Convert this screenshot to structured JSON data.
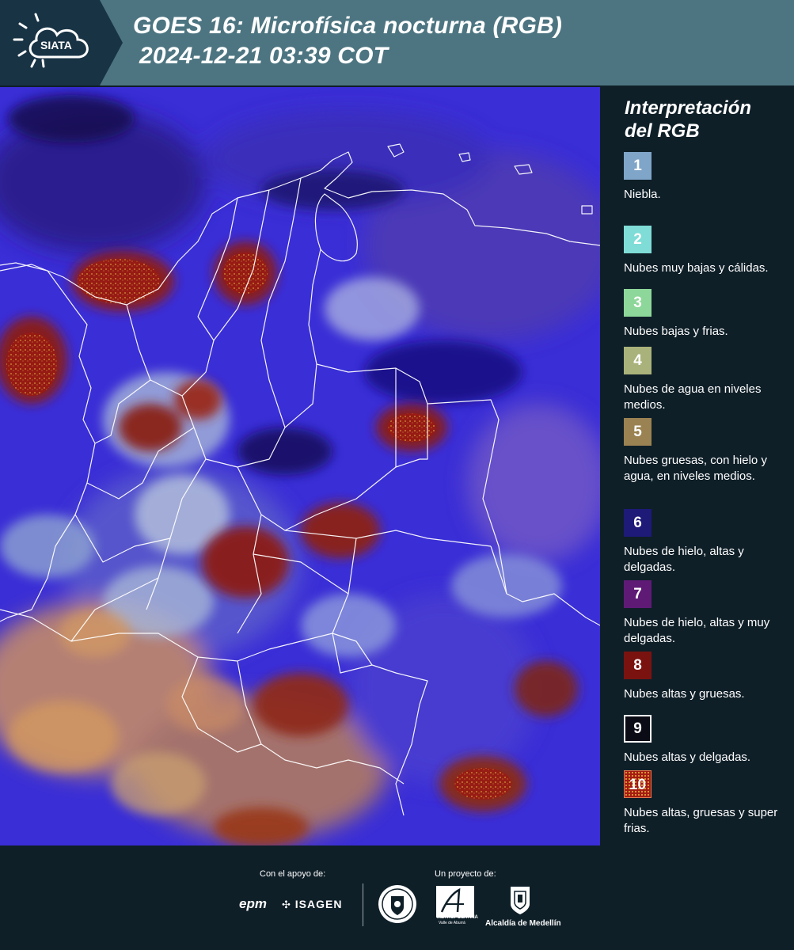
{
  "header": {
    "logo_text": "SIATA",
    "title_line1": "GOES 16: Microfísica nocturna (RGB)",
    "title_line2": "2024-12-21 03:39 COT"
  },
  "legend": {
    "title_line1": "Interpretación",
    "title_line2": "del RGB",
    "items": [
      {
        "number": "1",
        "color": "#7fa5c8",
        "label": "Niebla."
      },
      {
        "number": "2",
        "color": "#7fdcd6",
        "label": "Nubes muy bajas y cálidas."
      },
      {
        "number": "3",
        "color": "#8ed79a",
        "label": "Nubes bajas y frias."
      },
      {
        "number": "4",
        "color": "#a9b27a",
        "label": "Nubes de agua en niveles medios."
      },
      {
        "number": "5",
        "color": "#9a8252",
        "label": "Nubes gruesas, con hielo y agua, en niveles medios."
      },
      {
        "number": "6",
        "color": "#1d1a78",
        "label": "Nubes de hielo, altas y delgadas."
      },
      {
        "number": "7",
        "color": "#5f1a76",
        "label": "Nubes de hielo, altas y muy delgadas."
      },
      {
        "number": "8",
        "color": "#7a1310",
        "label": "Nubes altas y gruesas."
      },
      {
        "number": "9",
        "color": "#0b0b16",
        "label": "Nubes altas y delgadas."
      },
      {
        "number": "10",
        "color": "#a51c12",
        "label": "Nubes altas, gruesas y super frias."
      }
    ]
  },
  "footer": {
    "support_caption": "Con el apoyo de:",
    "project_caption": "Un proyecto de:",
    "sponsor_epm": "epm",
    "sponsor_isagen": "ISAGEN",
    "partner_metropolitana": "METROPOLITANA",
    "partner_metropolitana_sub": "Valle de Aburrá",
    "partner_alcaldia": "Alcaldía de Medellín"
  },
  "colors": {
    "header_bg": "#4d7581",
    "panel_bg": "#0f1f28",
    "map_base": "#3a2fd8",
    "boundary": "#ffffff"
  }
}
